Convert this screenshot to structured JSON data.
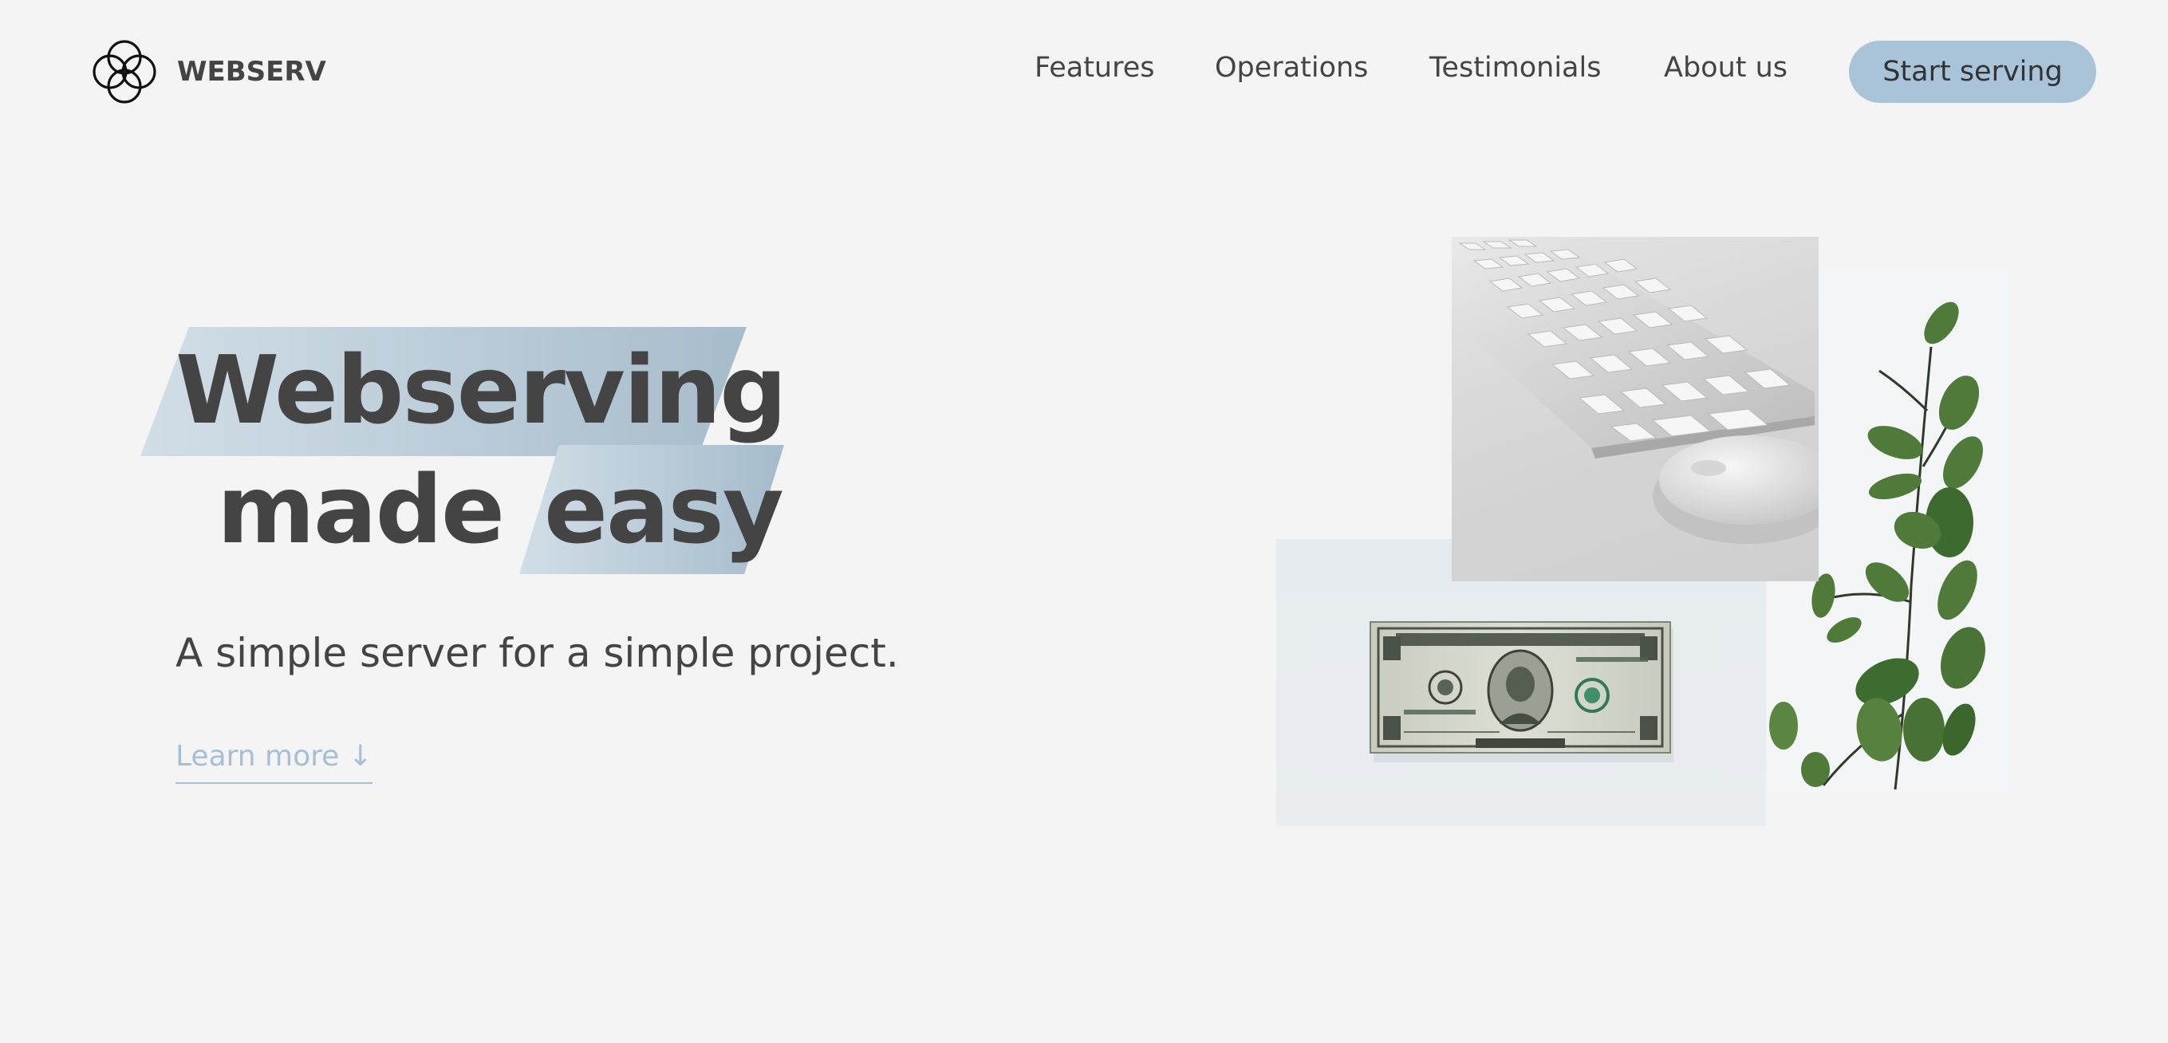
{
  "header": {
    "brand": "WEBSERV",
    "logo_icon": "four-circles-logo-icon",
    "nav": [
      {
        "label": "Features"
      },
      {
        "label": "Operations"
      },
      {
        "label": "Testimonials"
      },
      {
        "label": "About us"
      }
    ],
    "cta_label": "Start serving"
  },
  "hero": {
    "title_line1": "Webserving",
    "title_line2_word1": "made",
    "title_line2_word2": "easy",
    "subtitle": "A simple server for a simple project.",
    "learn_more": "Learn more ↓"
  },
  "collage": {
    "images": [
      {
        "name": "keyboard-and-mouse-photo"
      },
      {
        "name": "eucalyptus-plant-photo"
      },
      {
        "name": "one-dollar-bill-photo"
      }
    ]
  },
  "colors": {
    "background": "#f4f4f4",
    "text": "#444444",
    "accent": "#a9c3d8",
    "link": "#a6bfd4"
  }
}
